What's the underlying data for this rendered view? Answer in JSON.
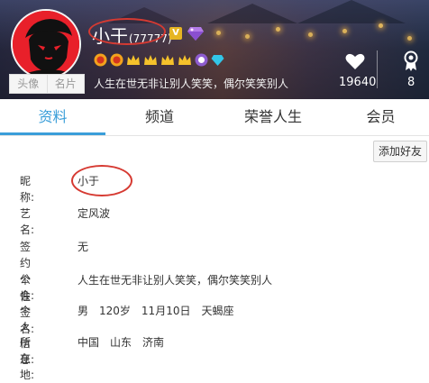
{
  "profile": {
    "nickname": "小于",
    "uid": "(77777)",
    "vip_badge": "V",
    "signature": "人生在世无非让别人笑笑，偶尔笑笑别人",
    "avatar_buttons": [
      "头像",
      "名片"
    ],
    "likes": "19640",
    "rank": "8"
  },
  "colors": {
    "accent": "#3a9ed9",
    "highlight_circle": "#d63a32",
    "avatar_bg": "#e8202a"
  },
  "icons": [
    "heart-icon",
    "ribbon-icon",
    "gem-icon",
    "crown-icon",
    "medal-icon",
    "diamond-icon"
  ],
  "tabs": [
    {
      "label": "资料",
      "active": true
    },
    {
      "label": "频道",
      "active": false
    },
    {
      "label": "荣誉人生",
      "active": false
    },
    {
      "label": "会员",
      "active": false
    }
  ],
  "add_friend_label": "添加好友",
  "info": {
    "nickname_label": "昵　称:",
    "nickname_value": "小于",
    "stage_label": "艺　名:",
    "stage_value": "定风波",
    "guild_label": "签约公会:",
    "guild_value": "无",
    "signature_label": "个性签名:",
    "signature_value": "人生在世无非让别人笑笑，偶尔笑笑别人",
    "personal_label": "个人信息:",
    "personal_values": [
      "男",
      "120岁",
      "11月10日",
      "天蝎座"
    ],
    "location_label": "所 在 地:",
    "location_values": [
      "中国",
      "山东",
      "济南"
    ]
  }
}
